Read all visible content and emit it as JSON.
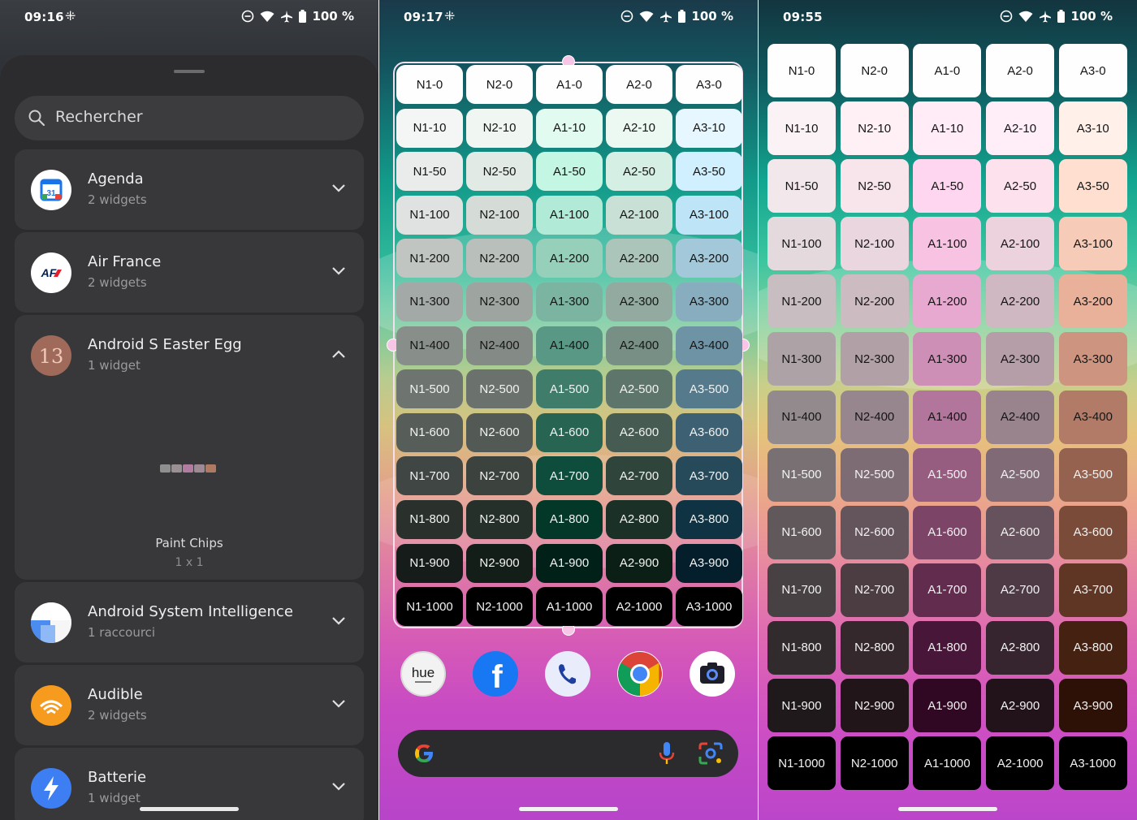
{
  "status_bars": [
    {
      "time": "09:16",
      "battery": "100 %"
    },
    {
      "time": "09:17",
      "battery": "100 %"
    },
    {
      "time": "09:55",
      "battery": "100 %"
    }
  ],
  "picker": {
    "search_placeholder": "Rechercher",
    "apps": [
      {
        "title": "Agenda",
        "subtitle": "2 widgets",
        "icon": "calendar-icon",
        "icon_text": "31"
      },
      {
        "title": "Air France",
        "subtitle": "2 widgets",
        "icon": "air-france-icon",
        "icon_text": "AF"
      },
      {
        "title": "Android S Easter Egg",
        "subtitle": "1 widget",
        "icon": "android-12-icon",
        "icon_text": "13"
      },
      {
        "title": "Android System Intelligence",
        "subtitle": "1 raccourci",
        "icon": "asi-icon"
      },
      {
        "title": "Audible",
        "subtitle": "2 widgets",
        "icon": "audible-icon"
      },
      {
        "title": "Batterie",
        "subtitle": "1 widget",
        "icon": "bolt-icon"
      }
    ],
    "preview": {
      "name": "Paint Chips",
      "size": "1 x 1"
    }
  },
  "chip_cols": [
    "N1",
    "N2",
    "A1",
    "A2",
    "A3"
  ],
  "chip_rows": [
    "0",
    "10",
    "50",
    "100",
    "200",
    "300",
    "400",
    "500",
    "600",
    "700",
    "800",
    "900",
    "1000"
  ],
  "palette_home": {
    "N1": [
      "#fefefe",
      "#f3f6f5",
      "#e9ecea",
      "#dfe2e0",
      "#c0c5c2",
      "#a3a9a6",
      "#888f8b",
      "#6e7571",
      "#575e5a",
      "#3f4643",
      "#2a312d",
      "#161c19",
      "#000000"
    ],
    "N2": [
      "#fefefe",
      "#f0f7f3",
      "#e2eae5",
      "#d5dcd8",
      "#b9c0bc",
      "#9ea5a1",
      "#848b87",
      "#6b716d",
      "#535a56",
      "#3c433f",
      "#26302b",
      "#131e19",
      "#000000"
    ],
    "A1": [
      "#fefefe",
      "#e1fbf1",
      "#c3f7e3",
      "#b1ead6",
      "#96d0bb",
      "#7bb4a0",
      "#589884",
      "#3f7d6a",
      "#276451",
      "#0e4d3b",
      "#033728",
      "#012018",
      "#000000"
    ],
    "A2": [
      "#fefefe",
      "#ebf9f2",
      "#d6efe4",
      "#c8e0d5",
      "#acc5ba",
      "#92aa9f",
      "#778f85",
      "#5e756b",
      "#465c53",
      "#2f453c",
      "#1b3128",
      "#0b1f17",
      "#000000"
    ],
    "A3": [
      "#fefefe",
      "#e7f7ff",
      "#d0efff",
      "#bde4f7",
      "#a2c8d9",
      "#87adbf",
      "#6e93a5",
      "#557a8b",
      "#3d6172",
      "#264a5a",
      "#103343",
      "#041f2b",
      "#000000"
    ]
  },
  "palette_lock": {
    "N1": [
      "#fefefe",
      "#fbf2f5",
      "#f2e7eb",
      "#e4d9dd",
      "#c8bdc1",
      "#ada3a7",
      "#938a8d",
      "#787073",
      "#60585b",
      "#484143",
      "#322b2d",
      "#1f191b",
      "#000000"
    ],
    "N2": [
      "#fefefe",
      "#fff0f6",
      "#f8e5ec",
      "#e9d6de",
      "#cdbbc2",
      "#b2a0a7",
      "#97868d",
      "#7d6c73",
      "#64545b",
      "#4c3d43",
      "#35282d",
      "#21151a",
      "#000000"
    ],
    "A1": [
      "#fefefe",
      "#ffecf7",
      "#ffd6ef",
      "#f8c2e3",
      "#e7a9d0",
      "#cd8fb6",
      "#b2769c",
      "#975d81",
      "#7c4467",
      "#622c4e",
      "#481638",
      "#300823",
      "#000000"
    ],
    "A2": [
      "#fefefe",
      "#ffedf7",
      "#fde2ee",
      "#ecd2dd",
      "#d0b8c2",
      "#b59ea8",
      "#99848e",
      "#7f6a75",
      "#66525c",
      "#4d3a44",
      "#36252e",
      "#22131b",
      "#000000"
    ],
    "A3": [
      "#fefefe",
      "#fff0e9",
      "#ffdfcf",
      "#f6cbb7",
      "#e9b09a",
      "#cd9580",
      "#b17b67",
      "#94624f",
      "#7a4b38",
      "#5f3524",
      "#452112",
      "#2e1106",
      "#000000"
    ]
  },
  "dock": [
    {
      "name": "hue-app",
      "label": "hue"
    },
    {
      "name": "facebook-app",
      "label": "f"
    },
    {
      "name": "phone-app",
      "label": ""
    },
    {
      "name": "chrome-app",
      "label": ""
    },
    {
      "name": "camera-app",
      "label": ""
    }
  ]
}
